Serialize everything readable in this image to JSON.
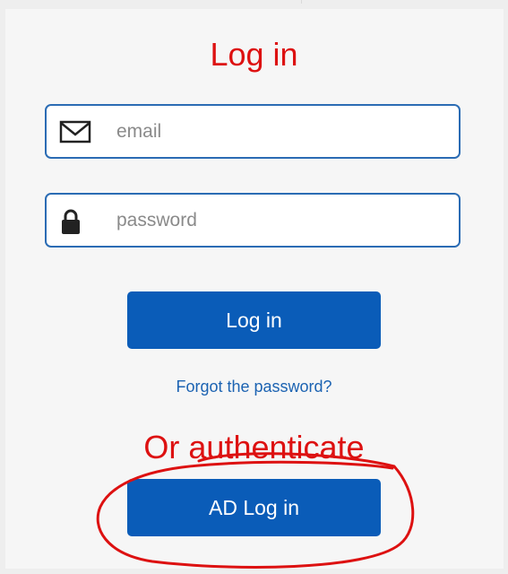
{
  "page": {
    "title": "Log in"
  },
  "email": {
    "placeholder": "email",
    "icon": "mail-icon"
  },
  "password": {
    "placeholder": "password",
    "icon": "lock-icon"
  },
  "login_button": {
    "label": "Log in"
  },
  "forgot_link": {
    "label": "Forgot the password?"
  },
  "annotation": {
    "text": "Or authenticate"
  },
  "ad_login_button": {
    "label": "AD Log in"
  },
  "colors": {
    "accent": "#0a5cb8",
    "field_border": "#2b6cb4",
    "link": "#1c63b2",
    "annotation": "#dd1111"
  }
}
